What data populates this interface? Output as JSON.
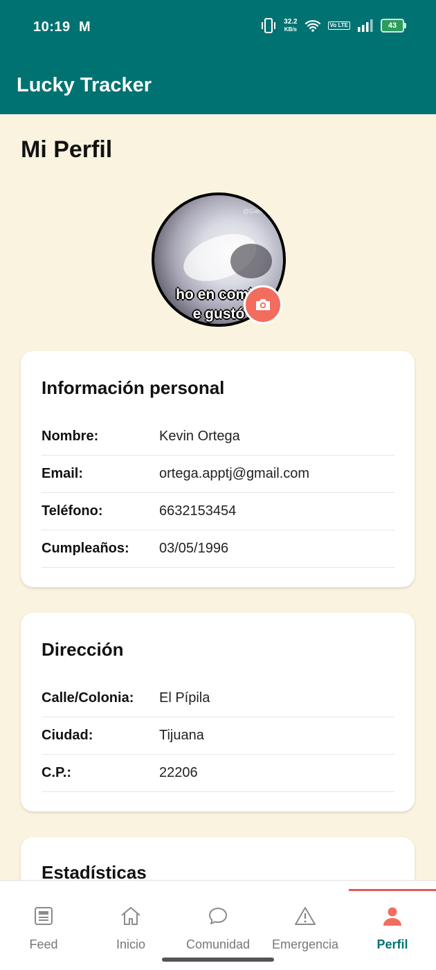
{
  "status_bar": {
    "time": "10:19",
    "gmail_glyph": "M",
    "net_speed_value": "32.2",
    "net_speed_unit": "KB/s",
    "volte_label": "Vo LTE",
    "battery": "43"
  },
  "app": {
    "title": "Lucky Tracker",
    "brand_color": "#007272"
  },
  "page": {
    "title": "Mi Perfil"
  },
  "avatar": {
    "caption_line1": "ho en comid",
    "caption_line2": "e gustó",
    "watermark": "@GatosPa"
  },
  "personal_info": {
    "title": "Información personal",
    "rows": [
      {
        "label": "Nombre:",
        "value": "Kevin Ortega"
      },
      {
        "label": "Email:",
        "value": "ortega.apptj@gmail.com"
      },
      {
        "label": "Teléfono:",
        "value": "6632153454"
      },
      {
        "label": "Cumpleaños:",
        "value": "03/05/1996"
      }
    ]
  },
  "address": {
    "title": "Dirección",
    "rows": [
      {
        "label": "Calle/Colonia:",
        "value": "El Pípila"
      },
      {
        "label": "Ciudad:",
        "value": "Tijuana"
      },
      {
        "label": "C.P.:",
        "value": "22206"
      }
    ]
  },
  "stats": {
    "title": "Estadísticas"
  },
  "bottom_nav": {
    "items": [
      {
        "label": "Feed",
        "icon": "newspaper-icon"
      },
      {
        "label": "Inicio",
        "icon": "home-icon"
      },
      {
        "label": "Comunidad",
        "icon": "chat-bubble-icon"
      },
      {
        "label": "Emergencia",
        "icon": "warning-icon"
      },
      {
        "label": "Perfil",
        "icon": "person-icon"
      }
    ],
    "active_index": 4,
    "active_color": "#f26d5e"
  }
}
